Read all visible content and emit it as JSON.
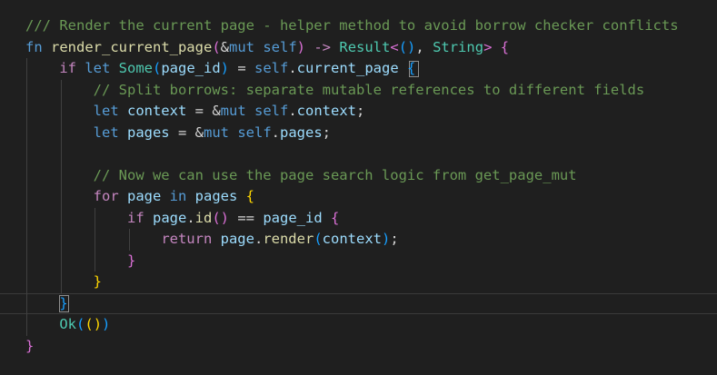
{
  "editor": {
    "language_hint": "rust-source-code",
    "background": "#1f1f1f",
    "theme": {
      "comment": "#6A9955",
      "keyword": "#569CD6",
      "control": "#C586C0",
      "function": "#DCDCAA",
      "type": "#4EC9B0",
      "variable": "#9CDCFE",
      "punct": "#D4D4D4",
      "b1": "#FFD700",
      "b2": "#DA70D6",
      "b3": "#179FFF",
      "indent_guide": "#404040",
      "current_line_border": "#3a3a3a",
      "bracket_match_border": "#8d8d8d"
    },
    "lines": [
      {
        "tokens": [
          {
            "t": "/// Render the current page - helper method to avoid borrow checker conflicts",
            "c": "comment"
          }
        ]
      },
      {
        "tokens": [
          {
            "t": "fn ",
            "c": "keyword"
          },
          {
            "t": "render_current_page",
            "c": "function"
          },
          {
            "t": "(",
            "c": "b2"
          },
          {
            "t": "&",
            "c": "punct"
          },
          {
            "t": "mut ",
            "c": "keyword"
          },
          {
            "t": "self",
            "c": "keyword"
          },
          {
            "t": ")",
            "c": "b2"
          },
          {
            "t": " ",
            "c": "punct"
          },
          {
            "t": "->",
            "c": "control"
          },
          {
            "t": " ",
            "c": "punct"
          },
          {
            "t": "Result",
            "c": "type"
          },
          {
            "t": "<",
            "c": "b2"
          },
          {
            "t": "(",
            "c": "b3"
          },
          {
            "t": ")",
            "c": "b3"
          },
          {
            "t": ", ",
            "c": "punct"
          },
          {
            "t": "String",
            "c": "type"
          },
          {
            "t": ">",
            "c": "b2"
          },
          {
            "t": " ",
            "c": "punct"
          },
          {
            "t": "{",
            "c": "b2"
          }
        ]
      },
      {
        "tokens": [
          {
            "t": "    ",
            "c": "punct"
          },
          {
            "t": "if ",
            "c": "control"
          },
          {
            "t": "let ",
            "c": "keyword"
          },
          {
            "t": "Some",
            "c": "type"
          },
          {
            "t": "(",
            "c": "b3"
          },
          {
            "t": "page_id",
            "c": "variable"
          },
          {
            "t": ")",
            "c": "b3"
          },
          {
            "t": " = ",
            "c": "punct"
          },
          {
            "t": "self",
            "c": "keyword"
          },
          {
            "t": ".",
            "c": "punct"
          },
          {
            "t": "current_page ",
            "c": "variable"
          },
          {
            "t": "{",
            "c": "b3"
          }
        ]
      },
      {
        "tokens": [
          {
            "t": "        ",
            "c": "punct"
          },
          {
            "t": "// Split borrows: separate mutable references to different fields",
            "c": "comment"
          }
        ]
      },
      {
        "tokens": [
          {
            "t": "        ",
            "c": "punct"
          },
          {
            "t": "let ",
            "c": "keyword"
          },
          {
            "t": "context ",
            "c": "variable"
          },
          {
            "t": "= ",
            "c": "punct"
          },
          {
            "t": "&",
            "c": "punct"
          },
          {
            "t": "mut ",
            "c": "keyword"
          },
          {
            "t": "self",
            "c": "keyword"
          },
          {
            "t": ".",
            "c": "punct"
          },
          {
            "t": "context",
            "c": "variable"
          },
          {
            "t": ";",
            "c": "punct"
          }
        ]
      },
      {
        "tokens": [
          {
            "t": "        ",
            "c": "punct"
          },
          {
            "t": "let ",
            "c": "keyword"
          },
          {
            "t": "pages ",
            "c": "variable"
          },
          {
            "t": "= ",
            "c": "punct"
          },
          {
            "t": "&",
            "c": "punct"
          },
          {
            "t": "mut ",
            "c": "keyword"
          },
          {
            "t": "self",
            "c": "keyword"
          },
          {
            "t": ".",
            "c": "punct"
          },
          {
            "t": "pages",
            "c": "variable"
          },
          {
            "t": ";",
            "c": "punct"
          }
        ]
      },
      {
        "tokens": []
      },
      {
        "tokens": [
          {
            "t": "        ",
            "c": "punct"
          },
          {
            "t": "// Now we can use the page search logic from get_page_mut",
            "c": "comment"
          }
        ]
      },
      {
        "tokens": [
          {
            "t": "        ",
            "c": "punct"
          },
          {
            "t": "for ",
            "c": "control"
          },
          {
            "t": "page ",
            "c": "variable"
          },
          {
            "t": "in ",
            "c": "keyword"
          },
          {
            "t": "pages ",
            "c": "variable"
          },
          {
            "t": "{",
            "c": "b1"
          }
        ]
      },
      {
        "tokens": [
          {
            "t": "            ",
            "c": "punct"
          },
          {
            "t": "if ",
            "c": "control"
          },
          {
            "t": "page",
            "c": "variable"
          },
          {
            "t": ".",
            "c": "punct"
          },
          {
            "t": "id",
            "c": "function"
          },
          {
            "t": "(",
            "c": "b2"
          },
          {
            "t": ")",
            "c": "b2"
          },
          {
            "t": " == ",
            "c": "punct"
          },
          {
            "t": "page_id ",
            "c": "variable"
          },
          {
            "t": "{",
            "c": "b2"
          }
        ]
      },
      {
        "tokens": [
          {
            "t": "                ",
            "c": "punct"
          },
          {
            "t": "return ",
            "c": "control"
          },
          {
            "t": "page",
            "c": "variable"
          },
          {
            "t": ".",
            "c": "punct"
          },
          {
            "t": "render",
            "c": "function"
          },
          {
            "t": "(",
            "c": "b3"
          },
          {
            "t": "context",
            "c": "variable"
          },
          {
            "t": ")",
            "c": "b3"
          },
          {
            "t": ";",
            "c": "punct"
          }
        ]
      },
      {
        "tokens": [
          {
            "t": "            ",
            "c": "punct"
          },
          {
            "t": "}",
            "c": "b2"
          }
        ]
      },
      {
        "tokens": [
          {
            "t": "        ",
            "c": "punct"
          },
          {
            "t": "}",
            "c": "b1"
          }
        ]
      },
      {
        "tokens": [
          {
            "t": "    ",
            "c": "punct"
          },
          {
            "t": "}",
            "c": "b3"
          }
        ]
      },
      {
        "tokens": [
          {
            "t": "    ",
            "c": "punct"
          },
          {
            "t": "Ok",
            "c": "type"
          },
          {
            "t": "(",
            "c": "b3"
          },
          {
            "t": "(",
            "c": "b1"
          },
          {
            "t": ")",
            "c": "b1"
          },
          {
            "t": ")",
            "c": "b3"
          }
        ]
      },
      {
        "tokens": [
          {
            "t": "}",
            "c": "b2"
          }
        ]
      }
    ],
    "decorations": {
      "indent_guides": [
        {
          "col": 0,
          "from_line": 3,
          "to_line": 15
        },
        {
          "col": 4,
          "from_line": 4,
          "to_line": 13
        },
        {
          "col": 8,
          "from_line": 10,
          "to_line": 12
        },
        {
          "col": 12,
          "from_line": 11,
          "to_line": 11
        }
      ],
      "current_line": 14,
      "bracket_matches": [
        {
          "line": 3,
          "col": 45
        },
        {
          "line": 14,
          "col": 4
        }
      ]
    }
  }
}
